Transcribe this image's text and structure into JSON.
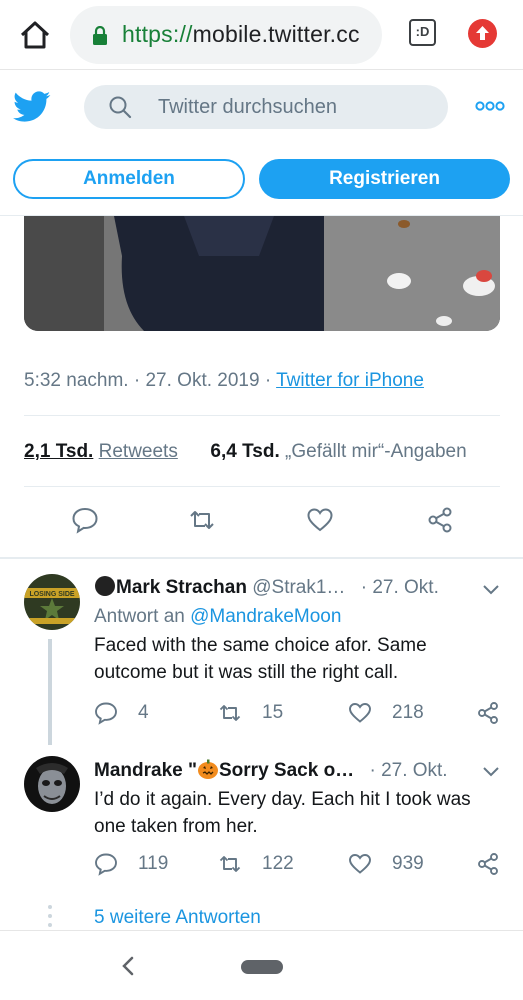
{
  "browser": {
    "url_scheme": "https://",
    "url_rest": "mobile.twitter.cc",
    "tab_count_label": ":D"
  },
  "twitter": {
    "search_placeholder": "Twitter durchsuchen",
    "login_label": "Anmelden",
    "register_label": "Registrieren",
    "brand_color": "#1da1f2"
  },
  "tweet": {
    "time": "5:32 nachm.",
    "separator": " · ",
    "date": "27. Okt. 2019",
    "source": "Twitter for iPhone",
    "retweets_count": "2,1 Tsd.",
    "retweets_label": "Retweets",
    "likes_count": "6,4 Tsd.",
    "likes_label": "„Gefällt mir“-Angaben"
  },
  "replies": [
    {
      "name": "Mark Strachan",
      "handle": "@Strak1…",
      "date": "27. Okt.",
      "reply_to_prefix": "Antwort an ",
      "reply_to": "@MandrakeMoon",
      "text": "Faced with the same choice afor. Same outcome but it was still the right call.",
      "replies": "4",
      "retweets": "15",
      "likes": "218",
      "avatar_text": "LOSING SIDE"
    },
    {
      "name": "Mandrake \"",
      "name_rest": "Sorry Sack o…",
      "date": "27. Okt.",
      "text": "I’d do it again. Every day. Each hit I took was one taken from her.",
      "replies": "119",
      "retweets": "122",
      "likes": "939"
    }
  ],
  "more_replies_label": "5 weitere Antworten"
}
